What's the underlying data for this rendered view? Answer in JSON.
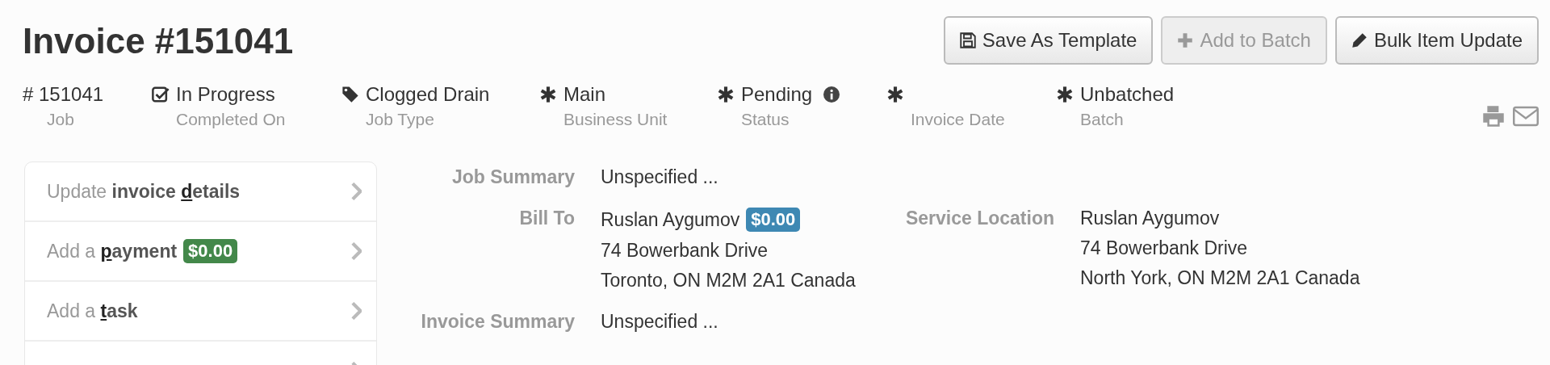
{
  "title": "Invoice #151041",
  "buttons": [
    {
      "label": "Save As Template",
      "disabled": false
    },
    {
      "label": "Add to Batch",
      "disabled": true
    },
    {
      "label": "Bulk Item Update",
      "disabled": false
    }
  ],
  "meta": [
    {
      "kind": "plain",
      "value": "# 151041",
      "label": "Job"
    },
    {
      "kind": "checkbox",
      "value": "In Progress",
      "label": "Completed On"
    },
    {
      "kind": "tag",
      "value": "Clogged Drain",
      "label": "Job Type"
    },
    {
      "kind": "required",
      "value": "Main",
      "label": "Business Unit"
    },
    {
      "kind": "required",
      "value": "Pending",
      "label": "Status",
      "info": true
    },
    {
      "kind": "required",
      "label": "Invoice Date"
    },
    {
      "kind": "required",
      "value": "Unbatched",
      "label": "Batch"
    }
  ],
  "actions": [
    {
      "lead": "Update",
      "bold_before": "invoice ",
      "key": "d",
      "bold_after": "etails"
    },
    {
      "lead": "Add a",
      "key": "p",
      "bold_after": "ayment",
      "badge": "$0.00"
    },
    {
      "lead": "Add a",
      "key": "t",
      "bold_after": "ask"
    }
  ],
  "job_summary": {
    "label": "Job Summary",
    "value": "Unspecified ..."
  },
  "bill_to": {
    "label": "Bill To",
    "name": "Ruslan Aygumov",
    "badge": "$0.00",
    "lines": [
      "74 Bowerbank Drive",
      "Toronto, ON M2M 2A1 Canada"
    ]
  },
  "service_location": {
    "label": "Service Location",
    "name": "Ruslan Aygumov",
    "lines": [
      "74 Bowerbank Drive",
      "North York, ON M2M 2A1 Canada"
    ]
  },
  "invoice_summary": {
    "label": "Invoice Summary",
    "value": "Unspecified ..."
  }
}
